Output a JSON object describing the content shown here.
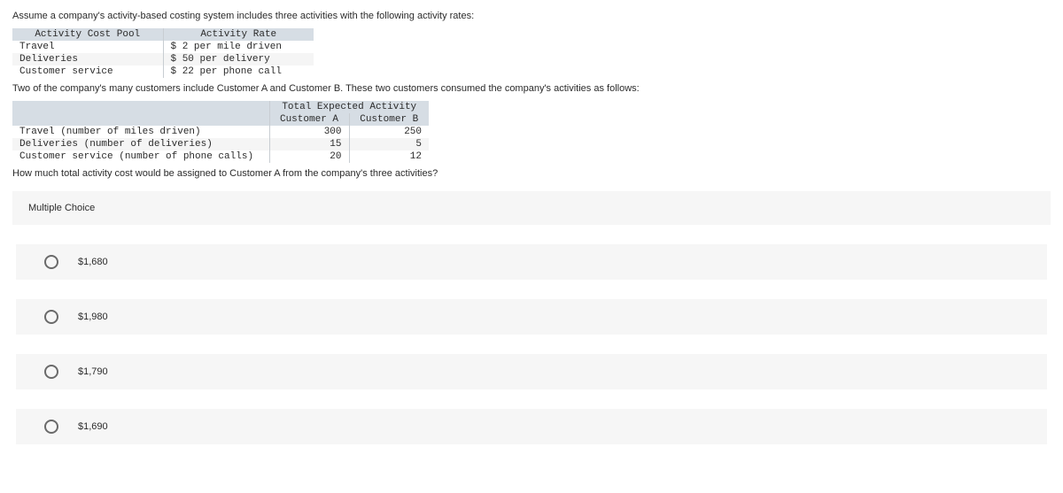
{
  "intro": "Assume a company's activity-based costing system includes three activities with the following activity rates:",
  "table1": {
    "col1_header": "Activity Cost Pool",
    "col2_header": "Activity Rate",
    "rows": [
      {
        "pool": "Travel",
        "rate": "$ 2 per mile driven"
      },
      {
        "pool": "Deliveries",
        "rate": "$ 50 per delivery"
      },
      {
        "pool": "Customer service",
        "rate": "$ 22 per phone call"
      }
    ]
  },
  "between": "Two of the company's many customers include Customer A and Customer B. These two customers consumed the company's activities as follows:",
  "table2": {
    "super_header": "Total Expected Activity",
    "colA": "Customer A",
    "colB": "Customer B",
    "rows": [
      {
        "label": "Travel (number of miles driven)",
        "a": "300",
        "b": "250"
      },
      {
        "label": "Deliveries (number of deliveries)",
        "a": "15",
        "b": "5"
      },
      {
        "label": "Customer service (number of phone calls)",
        "a": "20",
        "b": "12"
      }
    ]
  },
  "question": "How much total activity cost would be assigned to Customer A from the company's three activities?",
  "mc_label": "Multiple Choice",
  "options": [
    "$1,680",
    "$1,980",
    "$1,790",
    "$1,690"
  ]
}
